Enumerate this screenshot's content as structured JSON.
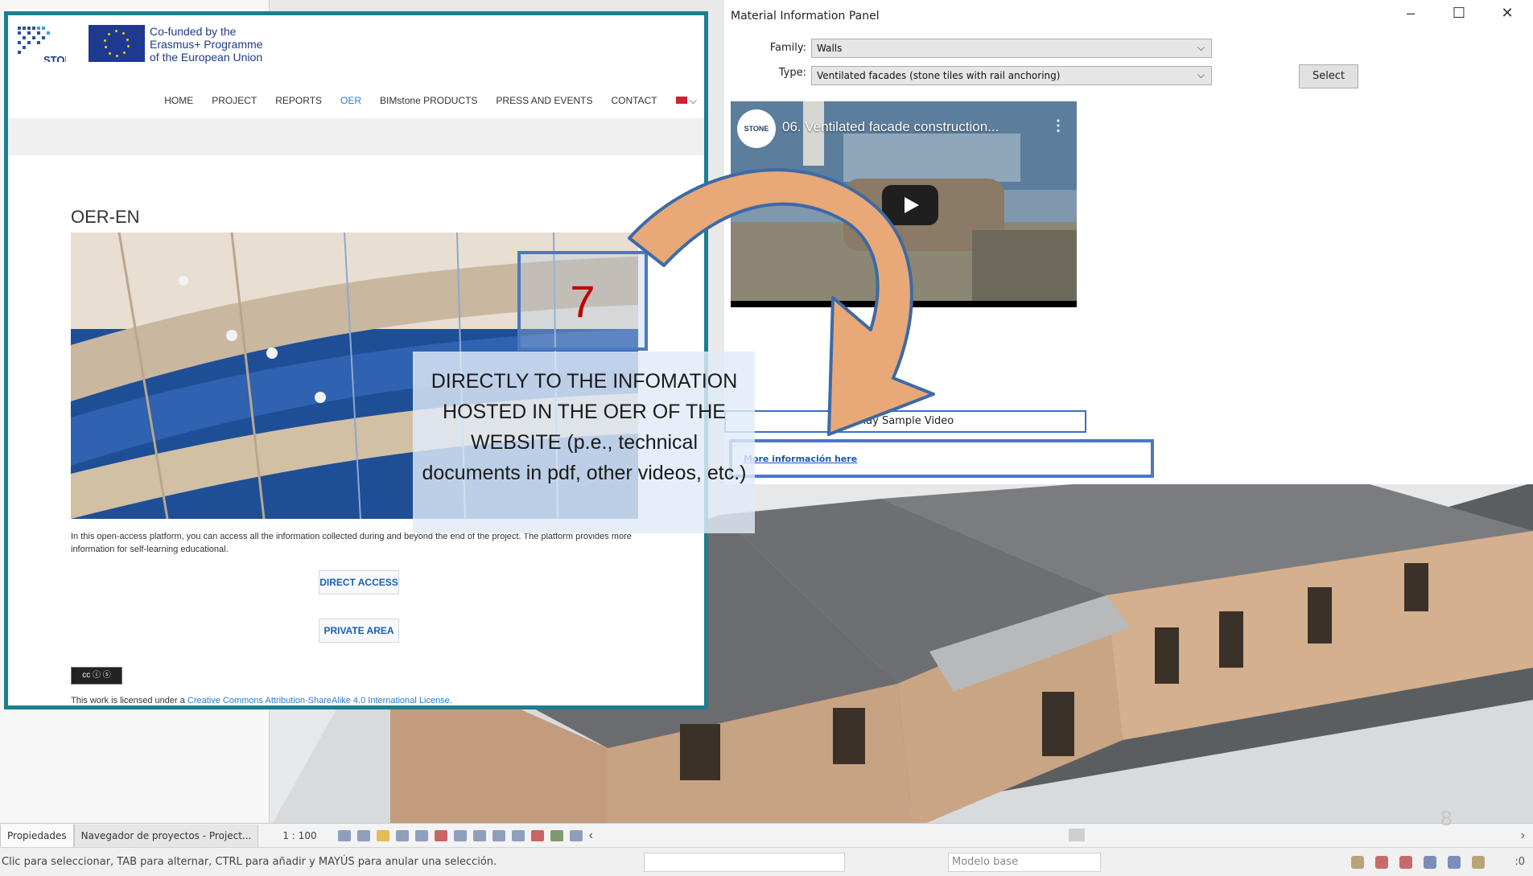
{
  "revit": {
    "scale": "1 : 100",
    "tabs": [
      "Propiedades",
      "Navegador de proyectos - Project..."
    ],
    "status_text": "Clic para seleccionar, TAB para alternar, CTRL para añadir y MAYÚS para anular una selección.",
    "model_base": "Modelo base",
    "filter_count": ":0",
    "slide_number": "8"
  },
  "panel": {
    "title": "Material Information Panel",
    "family_label": "Family:",
    "family_value": "Walls",
    "type_label": "Type:",
    "type_value": "Ventilated facades (stone tiles with rail anchoring)",
    "select_button": "Select",
    "video_title": "06. Ventilated facade construction...",
    "video_logo": "STONE",
    "play_sample_button": "Play Sample Video",
    "more_info_link": "More información here"
  },
  "website": {
    "eu_text": [
      "Co-funded by the",
      "Erasmus+ Programme",
      "of the European Union"
    ],
    "logo_text": "STONE",
    "nav": [
      "HOME",
      "PROJECT",
      "REPORTS",
      "OER",
      "BIMstone PRODUCTS",
      "PRESS AND EVENTS",
      "CONTACT"
    ],
    "active_nav": "OER",
    "page_title": "OER-EN",
    "paragraph": "In this open-access platform, you can access all the information collected during and beyond the end of the project. The platform provides more information for self-learning educational.",
    "direct_access": "DIRECT ACCESS",
    "private_area": "PRIVATE AREA",
    "license_prefix": "This work is licensed under a ",
    "license_link": "Creative Commons Attribution-ShareAlike 4.0 International License."
  },
  "annotation": {
    "step": "7",
    "callout": "DIRECTLY TO THE INFOMATION HOSTED IN THE OER OF THE WEBSITE (p.e., technical documents in pdf, other videos, etc.)"
  },
  "colors": {
    "frame": "#1b7f8f",
    "highlight_border": "#4a78c2",
    "arrow_fill": "#e8a878",
    "step_number": "#c00000",
    "link": "#1a57b8"
  }
}
